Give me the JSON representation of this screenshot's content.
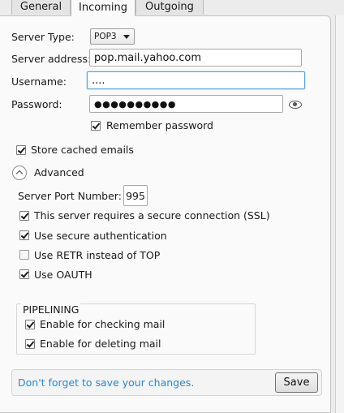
{
  "tabs": [
    {
      "label": "General",
      "active": false
    },
    {
      "label": "Incoming",
      "active": true
    },
    {
      "label": "Outgoing",
      "active": false
    }
  ],
  "server": {
    "type_label": "Server Type:",
    "type_value": "POP3",
    "address_label": "Server address:",
    "address_value": "pop.mail.yahoo.com",
    "username_label": "Username:",
    "username_value": "....",
    "password_label": "Password:",
    "password_value": "●●●●●●●●●●",
    "remember_label": "Remember password",
    "remember_checked": true
  },
  "store_cached": {
    "label": "Store cached emails",
    "checked": true
  },
  "advanced": {
    "label": "Advanced",
    "port_label": "Server Port Number:",
    "port_value": "995",
    "options": [
      {
        "label": "This server requires a secure connection (SSL)",
        "checked": true
      },
      {
        "label": "Use secure authentication",
        "checked": true
      },
      {
        "label": "Use RETR instead of TOP",
        "checked": false
      },
      {
        "label": "Use OAUTH",
        "checked": true
      }
    ]
  },
  "pipelining": {
    "header": "PIPELINING",
    "options": [
      {
        "label": "Enable for checking mail",
        "checked": true
      },
      {
        "label": "Enable for deleting mail",
        "checked": true
      }
    ]
  },
  "footer": {
    "message": "Don't forget to save your changes.",
    "save_label": "Save"
  },
  "icons": {
    "show_password": "eye-icon",
    "advanced_toggle": "chevron-up-icon",
    "select_arrow": "chevron-down-icon"
  },
  "colors": {
    "footer_message": "#2f86c5",
    "focus_border": "#5aa3d8"
  }
}
